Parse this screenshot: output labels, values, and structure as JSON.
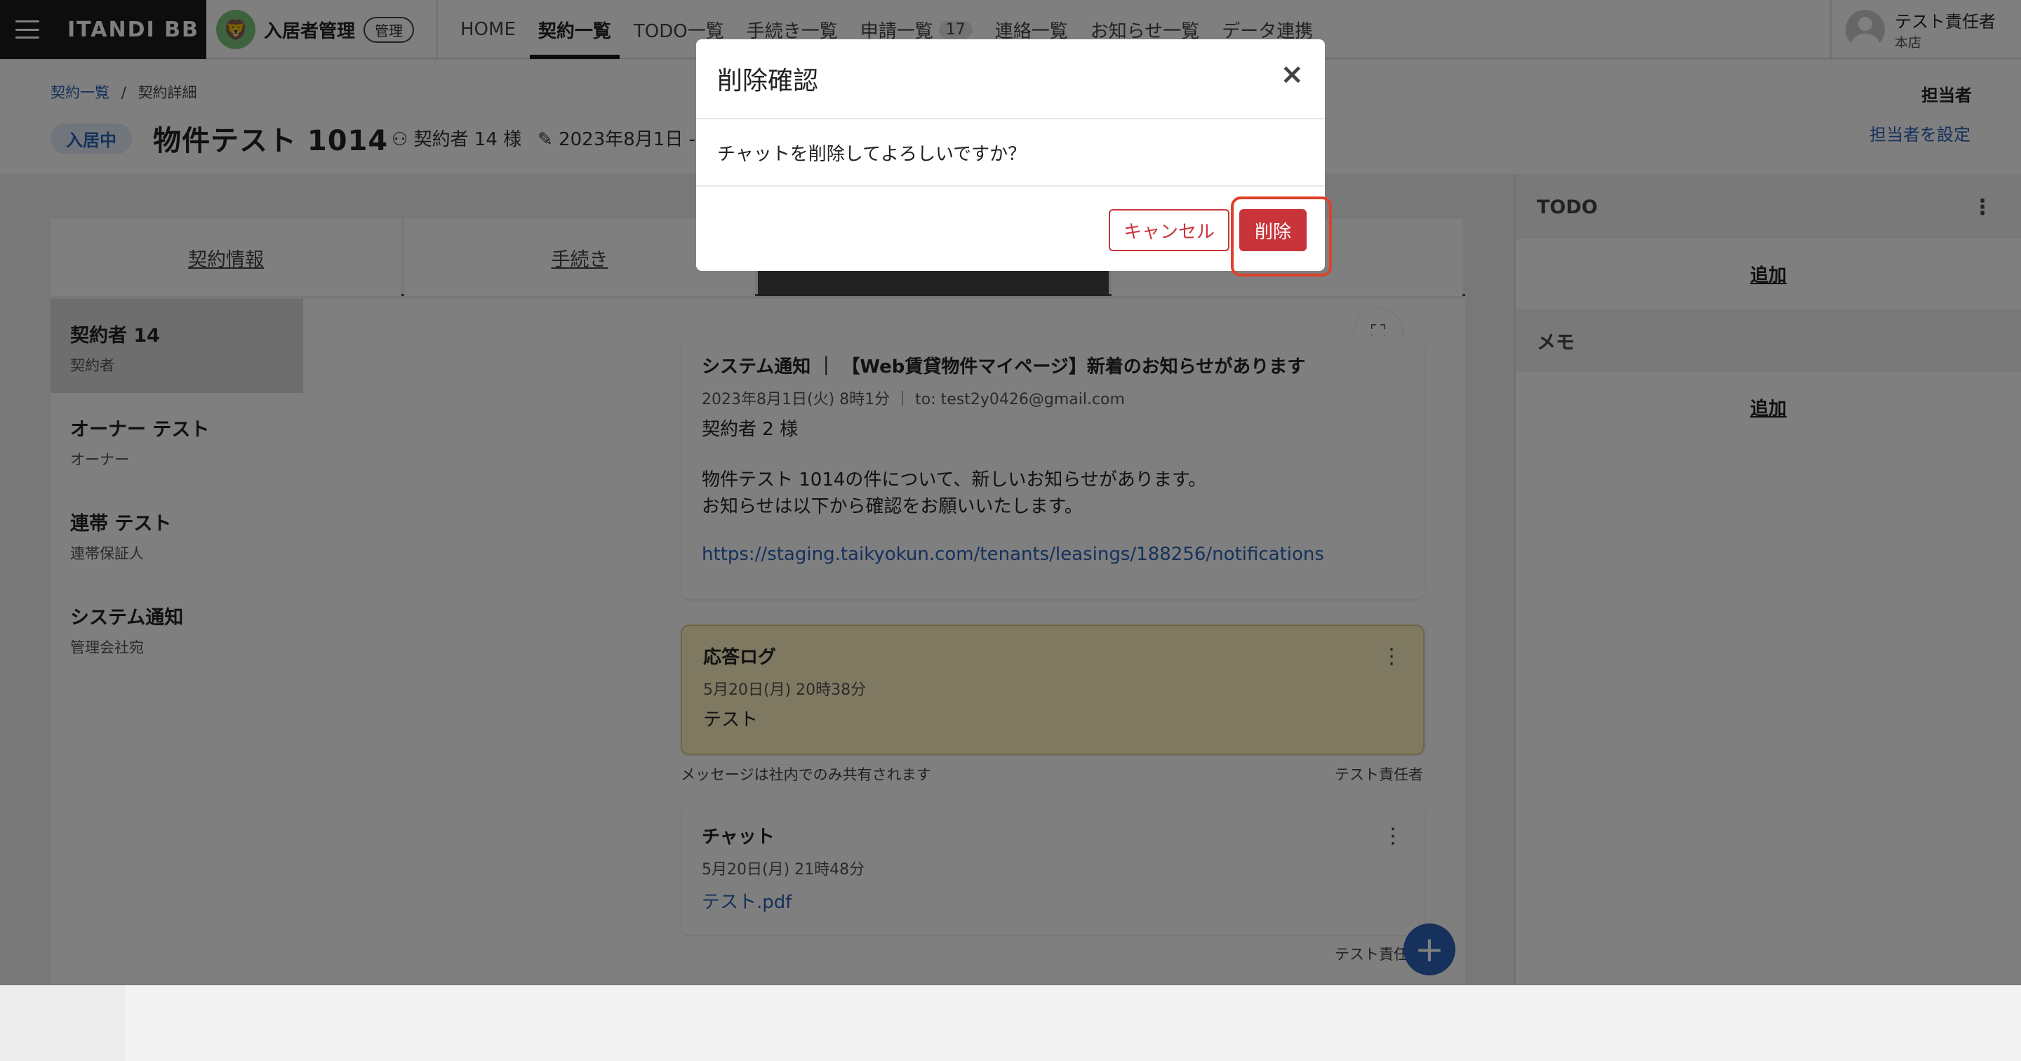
{
  "header": {
    "brand": "ITANDI BB",
    "app_name": "入居者管理",
    "admin_badge": "管理",
    "nav": [
      {
        "label": "HOME"
      },
      {
        "label": "契約一覧"
      },
      {
        "label": "TODO一覧"
      },
      {
        "label": "手続き一覧"
      },
      {
        "label": "申請一覧",
        "count": "17"
      },
      {
        "label": "連絡一覧"
      },
      {
        "label": "お知らせ一覧"
      },
      {
        "label": "データ連携"
      }
    ],
    "user_name": "テスト責任者",
    "user_branch": "本店"
  },
  "subheader": {
    "breadcrumb_parent": "契約一覧",
    "breadcrumb_sep": "/",
    "breadcrumb_current": "契約詳細",
    "status": "入居中",
    "title": "物件テスト 1014",
    "contractor": "契約者 14 様",
    "date": "2023年8月1日 -",
    "assignee_label": "担当者",
    "assignee_set": "担当者を設定"
  },
  "tabs": [
    {
      "label": "契約情報"
    },
    {
      "label": "手続き"
    }
  ],
  "contacts": [
    {
      "name": "契約者 14",
      "role": "契約者"
    },
    {
      "name": "オーナー テスト",
      "role": "オーナー"
    },
    {
      "name": "連帯 テスト",
      "role": "連帯保証人"
    },
    {
      "name": "システム通知",
      "role": "管理会社宛"
    }
  ],
  "messages": {
    "system": {
      "title": "システム通知 ｜ 【Web賃貸物件マイページ】新着のお知らせがあります",
      "time": "2023年8月1日(火) 8時1分 ｜ to: test2y0426@gmail.com",
      "line1": "契約者 2 様",
      "line2": "物件テスト 1014の件について、新しいお知らせがあります。",
      "line3": "お知らせは以下から確認をお願いいたします。",
      "link": "https://staging.taikyokun.com/tenants/leasings/188256/notifications"
    },
    "log": {
      "title": "応答ログ",
      "time": "5月20日(月) 20時38分",
      "body": "テスト",
      "foot_left": "メッセージは社内でのみ共有されます",
      "foot_right": "テスト責任者"
    },
    "chat": {
      "title": "チャット",
      "time": "5月20日(月) 21時48分",
      "file": "テスト.pdf",
      "foot_right": "テスト責任"
    }
  },
  "right_panel": {
    "todo_title": "TODO",
    "todo_add": "追加",
    "memo_title": "メモ",
    "memo_add": "追加"
  },
  "modal": {
    "title": "削除確認",
    "message": "チャットを削除してよろしいですか？",
    "cancel": "キャンセル",
    "delete": "削除"
  },
  "colors": {
    "accent": "#2a63b8",
    "danger": "#c9343a",
    "highlight": "#e0402a"
  }
}
